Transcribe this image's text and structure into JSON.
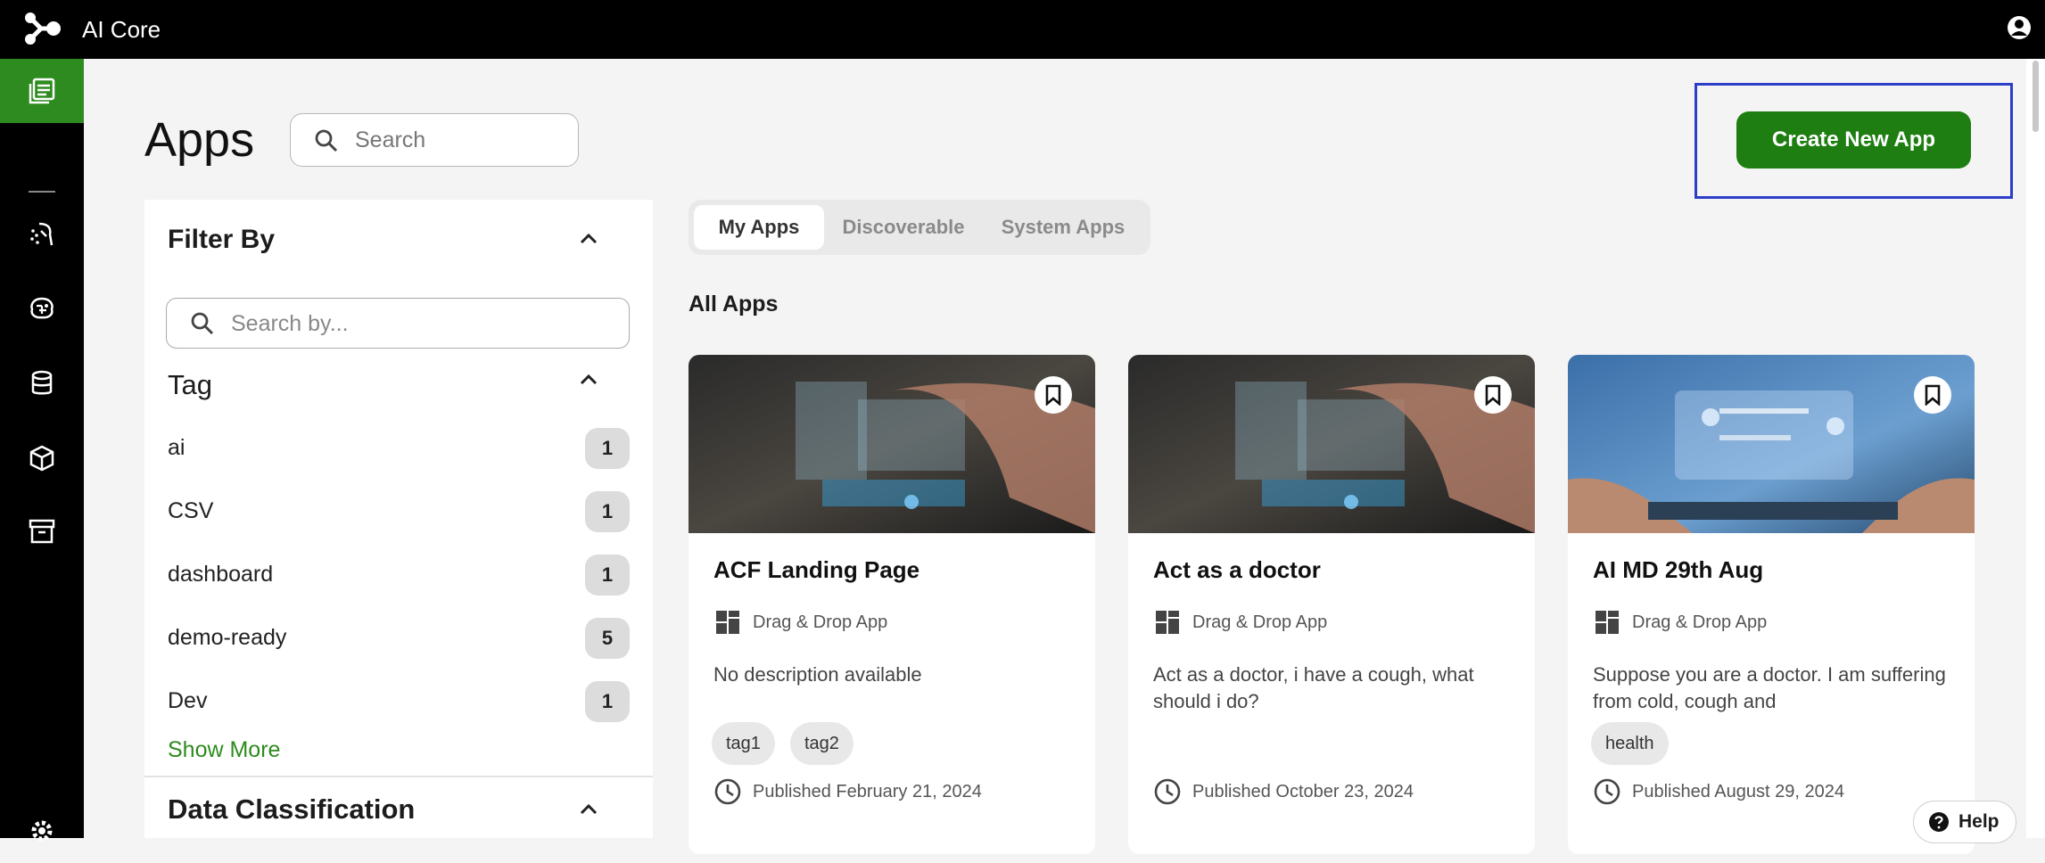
{
  "topbar": {
    "app_title": "AI Core"
  },
  "page": {
    "title": "Apps"
  },
  "search": {
    "placeholder": "Search"
  },
  "actions": {
    "create_label": "Create New App"
  },
  "filter": {
    "title": "Filter By",
    "search_placeholder": "Search by...",
    "tag_section": "Tag",
    "tags": [
      {
        "name": "ai",
        "count": "1"
      },
      {
        "name": "CSV",
        "count": "1"
      },
      {
        "name": "dashboard",
        "count": "1"
      },
      {
        "name": "demo-ready",
        "count": "5"
      },
      {
        "name": "Dev",
        "count": "1"
      }
    ],
    "show_more": "Show More",
    "data_classification": "Data Classification"
  },
  "tabs": [
    "My Apps",
    "Discoverable",
    "System Apps"
  ],
  "section_title": "All Apps",
  "apps": [
    {
      "title": "ACF Landing Page",
      "type": "Drag & Drop App",
      "description": "No description available",
      "tags": [
        "tag1",
        "tag2"
      ],
      "published": "Published February 21, 2024"
    },
    {
      "title": "Act as a doctor",
      "type": "Drag & Drop App",
      "description": "Act as a doctor, i have a cough, what should i do?",
      "tags": [],
      "published": "Published October 23, 2024"
    },
    {
      "title": "AI MD 29th Aug",
      "type": "Drag & Drop App",
      "description": "Suppose you are a doctor. I am suffering from cold, cough and",
      "tags": [
        "health"
      ],
      "published": "Published August 29, 2024"
    }
  ],
  "help": {
    "label": "Help"
  },
  "colors": {
    "brand_green": "#1e7e12",
    "nav_active": "#2e8b1f",
    "highlight_frame": "#2c3ec7"
  },
  "icons": [
    "logo-icon",
    "user-icon",
    "apps-icon",
    "prompt-icon",
    "model-icon",
    "database-icon",
    "storage-icon",
    "archive-icon",
    "settings-icon",
    "search-icon",
    "chevron-up-icon",
    "bookmark-icon",
    "grid-icon",
    "clock-icon",
    "help-icon"
  ]
}
